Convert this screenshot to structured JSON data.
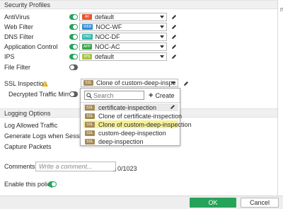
{
  "security_profiles": {
    "title": "Security Profiles",
    "antivirus": {
      "label": "AntiVirus",
      "enabled": true,
      "badge": "AV",
      "badge_color": "#e8542f",
      "value": "default"
    },
    "web_filter": {
      "label": "Web Filter",
      "enabled": true,
      "badge": "WEB",
      "badge_color": "#2f8ed1",
      "value": "NOC-WF"
    },
    "dns_filter": {
      "label": "DNS Filter",
      "enabled": true,
      "badge": "DNS",
      "badge_color": "#2db9b0",
      "value": "NOC-DF"
    },
    "app_control": {
      "label": "Application Control",
      "enabled": true,
      "badge": "APP",
      "badge_color": "#3aa64a",
      "value": "NOC-AC"
    },
    "ips": {
      "label": "IPS",
      "enabled": true,
      "badge": "IPS",
      "badge_color": "#a9c34a",
      "value": "default"
    },
    "file_filter": {
      "label": "File Filter",
      "enabled": false
    },
    "ssl_inspection": {
      "label": "SSL Inspection",
      "badge": "SSL",
      "badge_color": "#a58a56",
      "value": "Clone of custom-deep-inspecti"
    },
    "decrypted_traffic_mirror": {
      "label": "Decrypted Traffic Mirror",
      "enabled": false
    }
  },
  "ssl_dropdown": {
    "search_placeholder": "Search",
    "create_label": "Create",
    "options": [
      {
        "label": "certificate-inspection",
        "badge": "SSL"
      },
      {
        "label": "Clone of certificate-inspection",
        "badge": "SSL"
      },
      {
        "label": "Clone of custom-deep-inspection",
        "badge": "SSL"
      },
      {
        "label": "custom-deep-inspection",
        "badge": "SSL"
      },
      {
        "label": "deep-inspection",
        "badge": "SSL"
      }
    ]
  },
  "logging_options": {
    "title": "Logging Options",
    "log_allowed_traffic": "Log Allowed Traffic",
    "generate_logs": "Generate Logs when Session Sta",
    "capture_packets": "Capture Packets"
  },
  "comments": {
    "label": "Comments",
    "placeholder": "Write a comment...",
    "counter": "0/1023"
  },
  "enable_policy": {
    "label": "Enable this policy",
    "enabled": true
  },
  "footer": {
    "ok_label": "OK",
    "cancel_label": "Cancel"
  },
  "colors": {
    "accent_green": "#26a35a",
    "highlight_yellow": "#f5f197"
  },
  "right_peek_text": "n"
}
